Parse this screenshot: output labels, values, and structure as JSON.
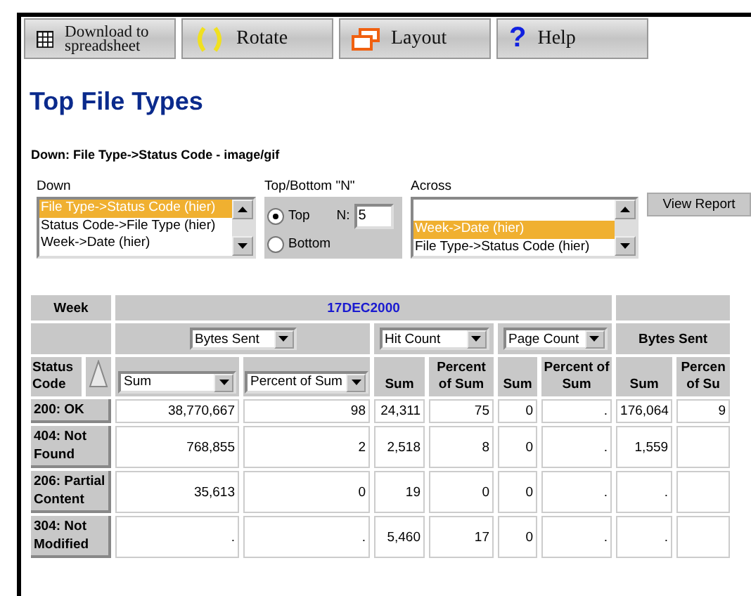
{
  "toolbar": [
    {
      "kind": "spreadsheet",
      "label": "Download to spreadsheet"
    },
    {
      "kind": "rotate",
      "label": "Rotate"
    },
    {
      "kind": "layout",
      "label": "Layout"
    },
    {
      "kind": "help",
      "glyph": "?",
      "label": "Help"
    }
  ],
  "title": "Top File Types",
  "subtitle": "Down: File Type->Status Code - image/gif",
  "controls": {
    "down": {
      "label": "Down",
      "options": [
        {
          "label": "File Type->Status Code (hier)",
          "selected": true
        },
        {
          "label": "Status Code->File Type (hier)",
          "selected": false
        },
        {
          "label": "Week->Date (hier)",
          "selected": false
        }
      ]
    },
    "topn": {
      "label": "Top/Bottom \"N\"",
      "options": [
        {
          "label": "Top",
          "selected": true
        },
        {
          "label": "Bottom",
          "selected": false
        }
      ],
      "n_label": "N:",
      "n_value": "5"
    },
    "across": {
      "label": "Across",
      "options": [
        {
          "label": "Week->Date (hier)",
          "selected": true
        },
        {
          "label": "File Type->Status Code (hier)",
          "selected": false
        }
      ]
    },
    "view_button": "View Report"
  },
  "table": {
    "week_label": "Week",
    "weeks": [
      "17DEC2000"
    ],
    "measures": [
      {
        "kind": "select",
        "label": "Bytes Sent"
      },
      {
        "kind": "select",
        "label": "Hit Count"
      },
      {
        "kind": "select",
        "label": "Page Count"
      },
      {
        "kind": "text",
        "label": "Bytes Sent"
      }
    ],
    "row_header": "Status Code",
    "stats": [
      {
        "kind": "select",
        "label": "Sum"
      },
      {
        "kind": "select",
        "label": "Percent of Sum"
      },
      {
        "kind": "text",
        "label": "Sum"
      },
      {
        "kind": "text",
        "label": "Percent of Sum"
      },
      {
        "kind": "text",
        "label": "Sum"
      },
      {
        "kind": "text",
        "label": "Percent of Sum"
      },
      {
        "kind": "text",
        "label": "Sum"
      },
      {
        "kind": "text",
        "label": "Percen of Su"
      }
    ],
    "rows": [
      {
        "label": "200: OK",
        "cells": [
          "38,770,667",
          "98",
          "24,311",
          "75",
          "0",
          ".",
          "176,064",
          "9"
        ]
      },
      {
        "label": "404: Not Found",
        "cells": [
          "768,855",
          "2",
          "2,518",
          "8",
          "0",
          ".",
          "1,559",
          null
        ]
      },
      {
        "label": "206: Partial Content",
        "cells": [
          "35,613",
          "0",
          "19",
          "0",
          "0",
          ".",
          ".",
          null
        ]
      },
      {
        "label": "304: Not Modified",
        "cells": [
          ".",
          ".",
          "5,460",
          "17",
          "0",
          ".",
          ".",
          null
        ]
      }
    ]
  }
}
